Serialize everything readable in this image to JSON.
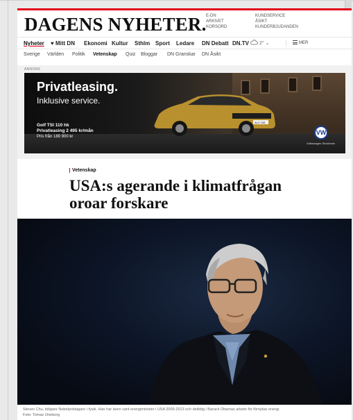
{
  "logo": "DAGENS NYHETER.",
  "top_links_col1": [
    "E-DN",
    "ARKIVET",
    "KORSORD"
  ],
  "top_links_col2": [
    "KUNDSERVICE",
    "ÅSIKT",
    "KUNDERBJUDANDEN"
  ],
  "main_nav": [
    "Nyheter",
    "♥ Mitt DN",
    "Ekonomi",
    "Kultur",
    "Sthlm",
    "Sport",
    "Ledare",
    "DN Debatt",
    "DN.TV"
  ],
  "weather": "2° ⌄",
  "menu_label": "MER",
  "sub_nav": [
    "Sverige",
    "Världen",
    "Politik",
    "Vetenskap",
    "Quiz",
    "Bloggar",
    "DN Granskar",
    "DN Åsikt"
  ],
  "sub_nav_active": "Vetenskap",
  "ad": {
    "label": "ANNONS",
    "title": "Privatleasing.",
    "subtitle": "Inklusive service.",
    "model": "Golf TSI 110 hk",
    "price_line": "Privatleasing 2 495 kr/mån",
    "price_from": "Pris från 189 900 kr",
    "brand_tag": "Volkswagen Stockholm",
    "plate": "ALX 155"
  },
  "article": {
    "kicker": "Vetenskap",
    "headline": "USA:s agerande i klimatfrågan oroar forskare",
    "caption": "Steven Chu, tidigare Nobelpristagare i fysik. Han har även varit energiminister i USA 2009-2013 och deltidig i Barack Obamas arbete för förnybar energi.",
    "photo_credit": "Foto: Tomas Oneborg"
  },
  "colors": {
    "brand_red": "#e2001a"
  }
}
